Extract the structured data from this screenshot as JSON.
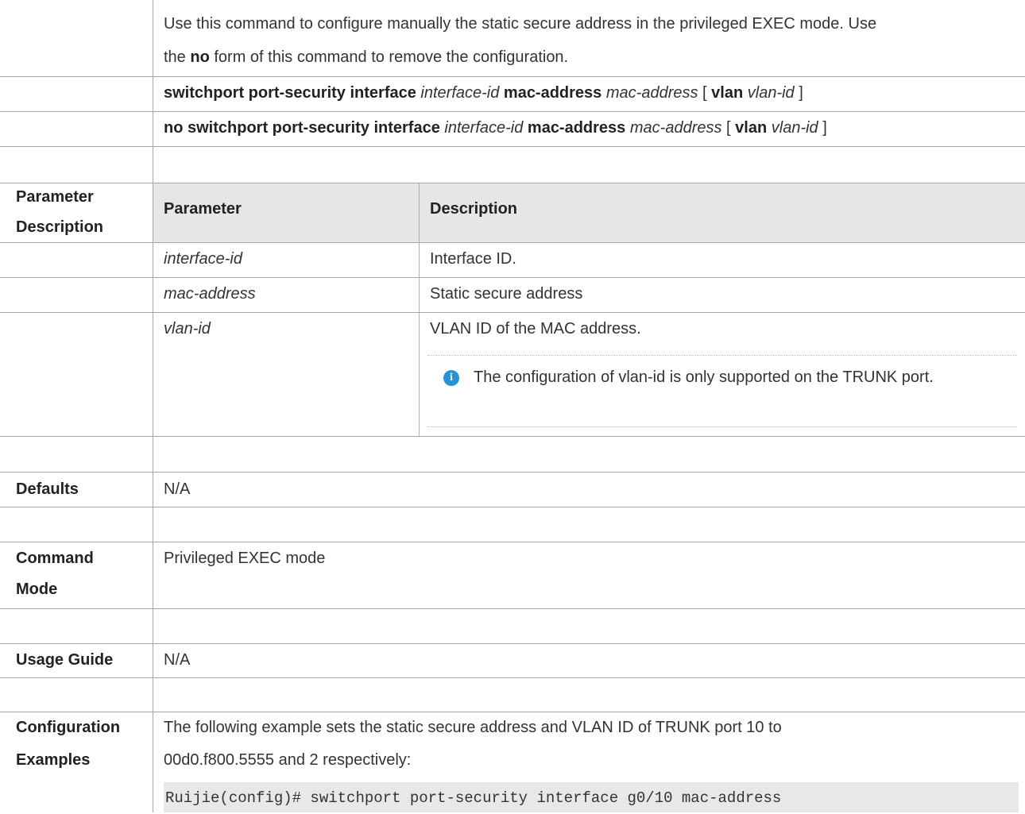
{
  "intro": {
    "line1": "Use this command to configure manually the static secure address in the privileged EXEC mode. Use",
    "line2_pre": "the ",
    "line2_bold": "no",
    "line2_post": " form of this command to remove the configuration."
  },
  "syntax": {
    "cmd": {
      "bold1": "switchport port-security interface",
      "it1": "interface-id",
      "bold2": "mac-address",
      "it2": "mac-address",
      "open": "[",
      "bold3": "vlan",
      "it3": "vlan-id",
      "close": "]"
    },
    "no_cmd": {
      "bold1": "no switchport port-security interface",
      "it1": "interface-id",
      "bold2": "mac-address",
      "it2": "mac-address",
      "open": "[",
      "bold3": "vlan",
      "it3": "vlan-id",
      "close": "]"
    }
  },
  "param_section": {
    "label_line1": "Parameter",
    "label_line2": "Description",
    "col_param": "Parameter",
    "col_desc": "Description",
    "rows": [
      {
        "param": "interface-id",
        "desc": "Interface ID."
      },
      {
        "param": "mac-address",
        "desc": "Static secure address"
      },
      {
        "param": "vlan-id",
        "desc": "VLAN ID of the MAC address."
      }
    ],
    "note": "The configuration of vlan-id is only supported on the TRUNK port."
  },
  "defaults": {
    "label": "Defaults",
    "value": "N/A"
  },
  "command_mode": {
    "label_line1": "Command",
    "label_line2": "Mode",
    "value": "Privileged EXEC mode"
  },
  "usage_guide": {
    "label": "Usage Guide",
    "value": "N/A"
  },
  "config_examples": {
    "label_line1": "Configuration",
    "label_line2": "Examples",
    "line1": "The following example sets the static secure address and VLAN ID of TRUNK port 10 to",
    "line2": "00d0.f800.5555 and 2 respectively:",
    "code": "Ruijie(config)# switchport port-security interface g0/10 mac-address"
  },
  "colors": {
    "note_icon": "#2a93d6",
    "table_header_bg": "#e6e6e6",
    "code_bg": "#e8e8e8"
  }
}
